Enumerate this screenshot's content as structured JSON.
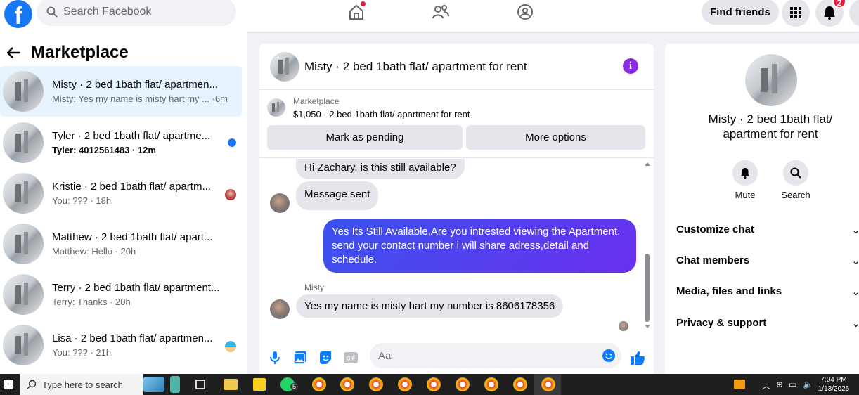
{
  "topbar": {
    "search_placeholder": "Search Facebook",
    "find_friends": "Find friends",
    "notifications_count": "2"
  },
  "sidebar": {
    "title": "Marketplace",
    "conversations": [
      {
        "title": "Misty · 2 bed 1bath flat/ apartmen...",
        "subtitle": "Misty: Yes my name is misty hart my ... ·6m",
        "unread": false
      },
      {
        "title": "Tyler · 2 bed 1bath flat/ apartme...",
        "subtitle": "Tyler: 4012561483 · 12m",
        "unread": true
      },
      {
        "title": "Kristie · 2 bed 1bath flat/ apartm...",
        "subtitle": "You: ??? · 18h",
        "unread": false
      },
      {
        "title": "Matthew · 2 bed 1bath flat/ apart...",
        "subtitle": "Matthew: Hello · 20h",
        "unread": false
      },
      {
        "title": "Terry · 2 bed 1bath flat/ apartment...",
        "subtitle": "Terry: Thanks · 20h",
        "unread": false
      },
      {
        "title": "Lisa · 2 bed 1bath flat/ apartmen...",
        "subtitle": "You: ??? · 21h",
        "unread": false
      }
    ]
  },
  "chat": {
    "title": "Misty · 2 bed 1bath flat/ apartment for rent",
    "listing_kicker": "Marketplace",
    "listing_price": "$1,050 - 2 bed 1bath flat/ apartment for rent",
    "mark_pending": "Mark as pending",
    "more_options": "More options",
    "messages": {
      "m1": "Hi Zachary, is this still available?",
      "m2": "Message sent",
      "m3": "Yes Its Still Available,Are you intrested viewing the Apartment. send your contact number i will share adress,detail and schedule.",
      "sender": "Misty",
      "m4": "Yes my name is misty hart my number is 8606178356"
    },
    "composer_placeholder": "Aa",
    "gif_label": "GIF"
  },
  "right_panel": {
    "title": "Misty · 2 bed 1bath flat/ apartment for rent",
    "mute_label": "Mute",
    "search_label": "Search",
    "rows": [
      "Customize chat",
      "Chat members",
      "Media, files and links",
      "Privacy & support"
    ]
  },
  "taskbar": {
    "search_placeholder": "Type here to search",
    "time": "7:04 PM",
    "date": "1/13/2026",
    "whatsapp_badge": "5"
  },
  "colors": {
    "facebook_blue": "#1877f2",
    "message_gradient_start": "#3a52ee",
    "message_gradient_end": "#6a2fee",
    "notification_red": "#e41e3f"
  }
}
